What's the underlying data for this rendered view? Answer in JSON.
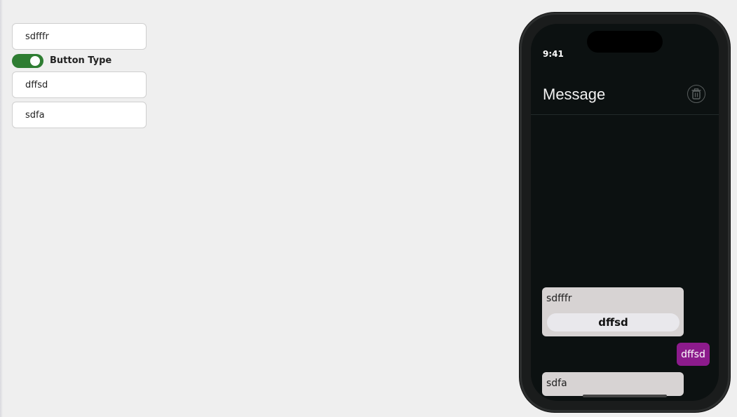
{
  "editor": {
    "message1_value": "sdfffr",
    "toggle_label": "Button Type",
    "toggle_on": true,
    "message2_value": "dffsd",
    "message3_value": "sdfa"
  },
  "phone": {
    "status_time": "9:41",
    "title": "Message",
    "messages": [
      {
        "type": "incoming",
        "text": "sdfffr",
        "button_label": "dffsd"
      },
      {
        "type": "outgoing",
        "text": "dffsd"
      },
      {
        "type": "incoming",
        "text": "sdfa"
      }
    ]
  },
  "colors": {
    "background": "#efefef",
    "toggle_on": "#2e7d32",
    "phone_screen": "#0c1111",
    "incoming_bubble": "#d7d3d3",
    "outgoing_bubble": "#8c1b8c"
  },
  "icons": {
    "delete": "trash-icon"
  }
}
